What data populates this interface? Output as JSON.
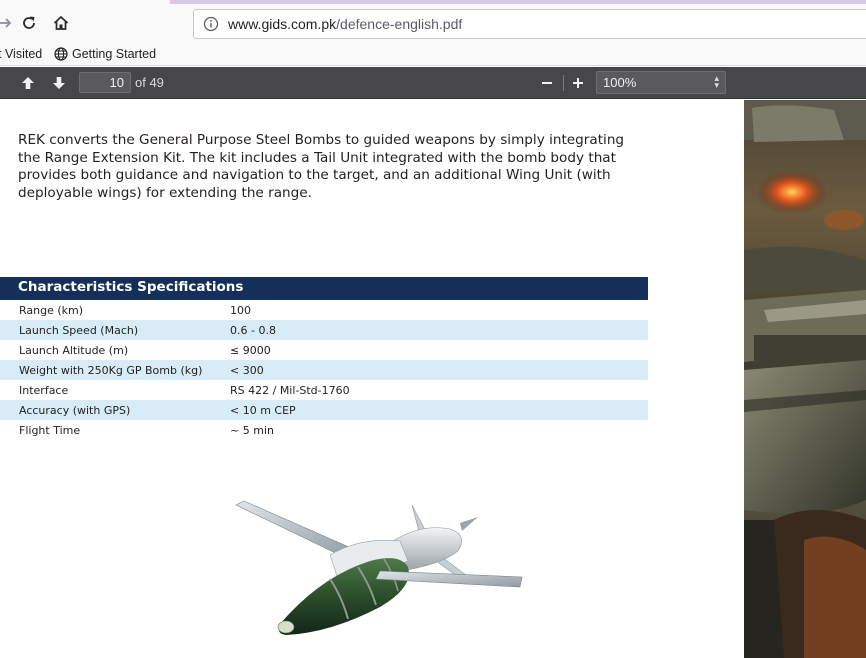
{
  "browser": {
    "url_host": "www.gids.com.pk",
    "url_path": "/defence-english.pdf",
    "bookmarks": [
      {
        "label": "t Visited"
      },
      {
        "label": "Getting Started"
      }
    ]
  },
  "pdf_toolbar": {
    "page_number": "10",
    "page_count": "of 49",
    "zoom": "100%"
  },
  "document": {
    "intro_lines": [
      "REK converts the General Purpose Steel Bombs to guided weapons by simply integrating",
      "the Range Extension Kit. The kit includes a Tail Unit integrated with the bomb body that",
      "provides both guidance and navigation to the target, and an additional Wing Unit (with",
      "deployable wings) for extending the range."
    ],
    "spec_title": "Characteristics Specifications",
    "specs": [
      {
        "label": "Range (km)",
        "value": "100"
      },
      {
        "label": "Launch Speed (Mach)",
        "value": "0.6 - 0.8"
      },
      {
        "label": "Launch Altitude (m)",
        "value": "≤ 9000"
      },
      {
        "label": "Weight with 250Kg GP Bomb (kg)",
        "value": "< 300"
      },
      {
        "label": "Interface",
        "value": "RS 422 / Mil-Std-1760"
      },
      {
        "label": "Accuracy (with GPS)",
        "value": "< 10 m CEP"
      },
      {
        "label": "Flight Time",
        "value": "~ 5 min"
      }
    ]
  },
  "colors": {
    "spec_header_bg": "#14305a",
    "spec_row_shaded": "#d7ecf7",
    "toolbar_bg": "#474749"
  },
  "icons": {
    "forward": "arrow-right-icon",
    "reload": "reload-icon",
    "home": "home-icon",
    "info": "info-icon",
    "globe": "globe-icon",
    "prev_page": "arrow-up-icon",
    "next_page": "arrow-down-icon",
    "zoom_out": "minus-icon",
    "zoom_in": "plus-icon"
  }
}
